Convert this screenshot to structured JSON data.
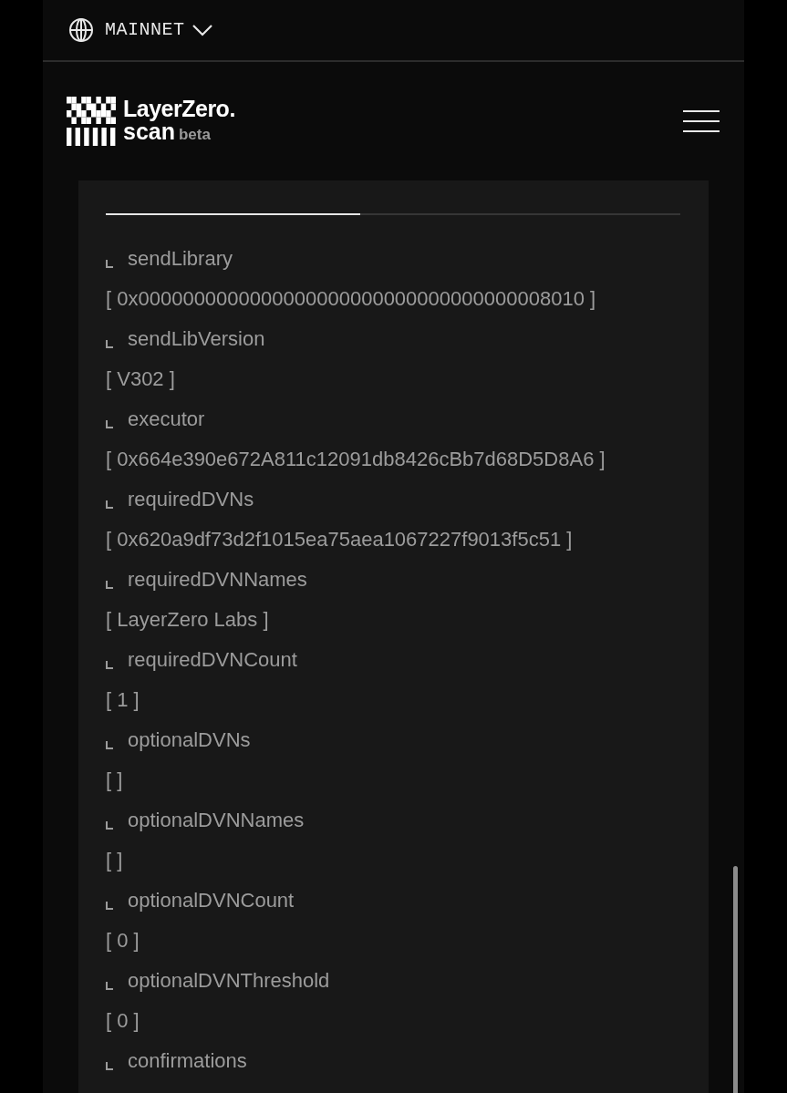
{
  "network": {
    "label": "MAINNET"
  },
  "brand": {
    "name": "LayerZero.",
    "product": "scan",
    "tag": "beta"
  },
  "tabs": [
    {
      "selected": true
    },
    {
      "selected": false
    }
  ],
  "fields": [
    {
      "label": "sendLibrary",
      "value": "[ 0x0000000000000000000000000000000000008010 ]"
    },
    {
      "label": "sendLibVersion",
      "value": "[ V302 ]"
    },
    {
      "label": "executor",
      "value": "[ 0x664e390e672A811c12091db8426cBb7d68D5D8A6 ]"
    },
    {
      "label": "requiredDVNs",
      "value": "[ 0x620a9df73d2f1015ea75aea1067227f9013f5c51 ]"
    },
    {
      "label": "requiredDVNNames",
      "value": "[ LayerZero Labs ]"
    },
    {
      "label": "requiredDVNCount",
      "value": "[ 1 ]"
    },
    {
      "label": "optionalDVNs",
      "value": "[ ]"
    },
    {
      "label": "optionalDVNNames",
      "value": "[ ]"
    },
    {
      "label": "optionalDVNCount",
      "value": "[ 0 ]"
    },
    {
      "label": "optionalDVNThreshold",
      "value": "[ 0 ]"
    },
    {
      "label": "confirmations"
    }
  ]
}
